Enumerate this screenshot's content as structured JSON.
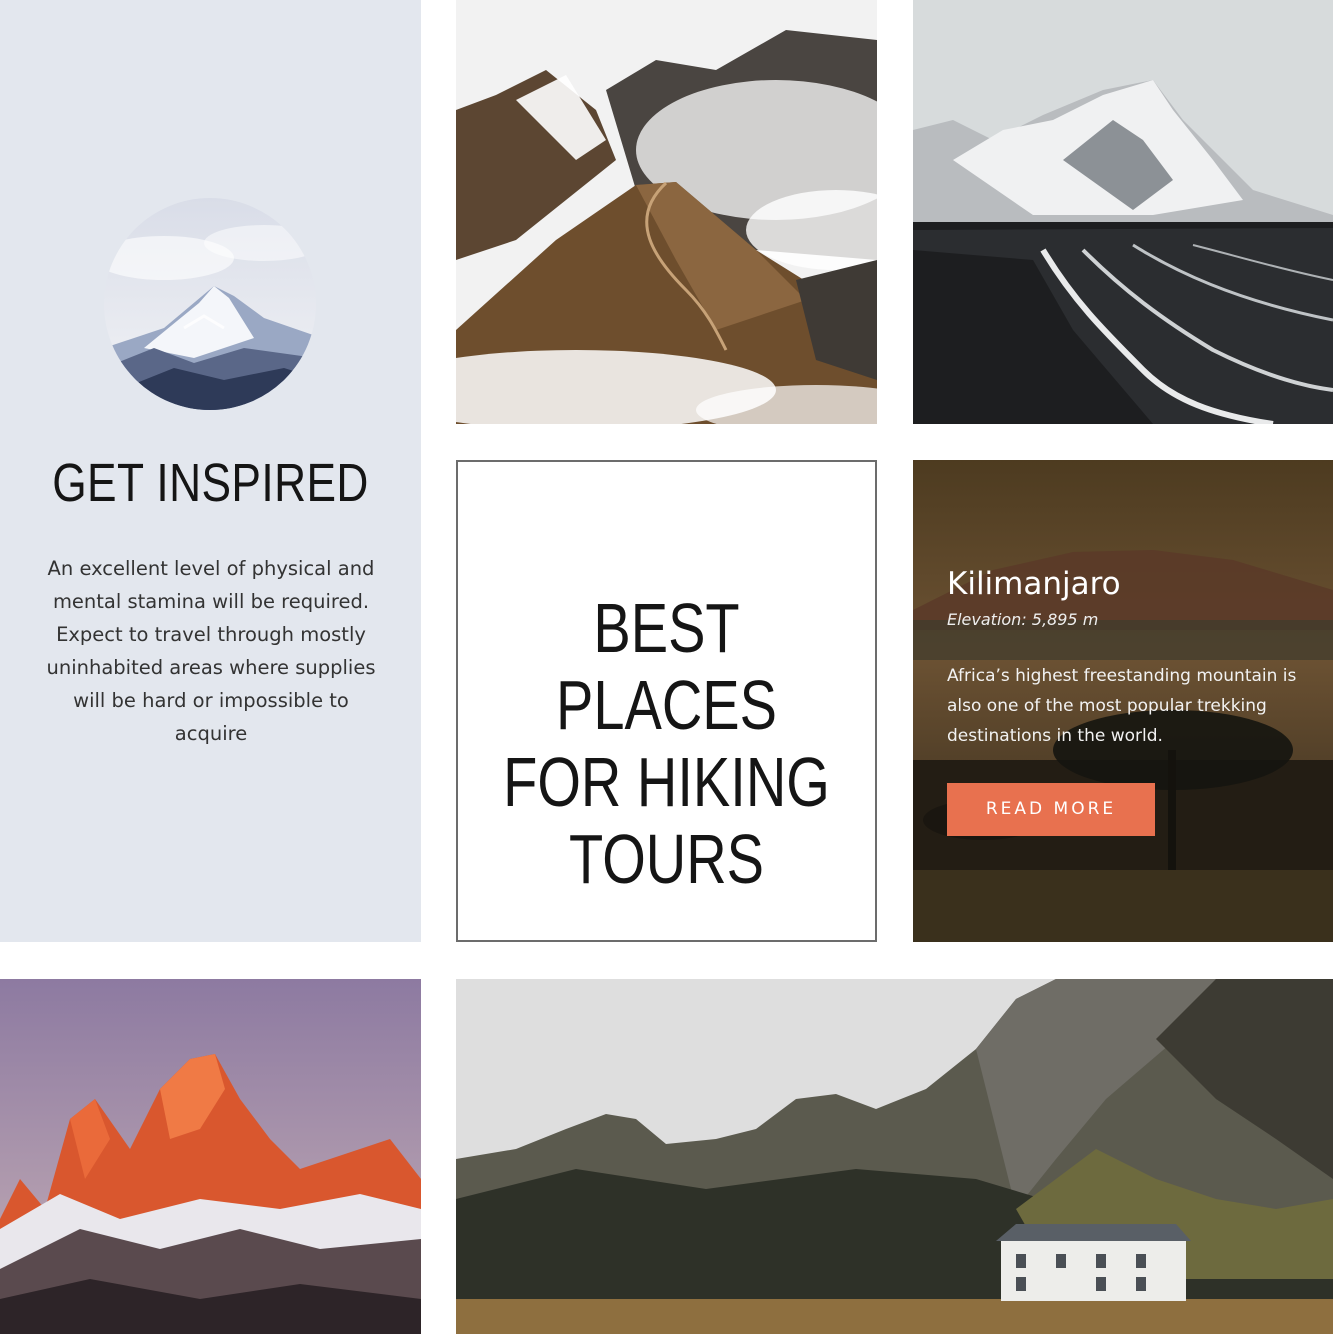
{
  "inspire": {
    "heading": "GET INSPIRED",
    "text": "An excellent level of physical and mental stamina will be required. Expect to travel through mostly uninhabited areas where supplies will be hard or impossible to acquire"
  },
  "center": {
    "title_line1": "BEST PLACES",
    "title_line2": "FOR HIKING",
    "title_line3": "TOURS"
  },
  "kilimanjaro": {
    "title": "Kilimanjaro",
    "elevation": "Elevation: 5,895 m",
    "description": "Africa’s highest freestanding mountain is also one of the most popular trekking destinations in the world.",
    "button_label": "READ MORE",
    "button_color": "#e8714f"
  },
  "colors": {
    "inspire_bg": "#e3e7ee",
    "center_border": "#6c6c6c",
    "text_dark": "#151515"
  }
}
